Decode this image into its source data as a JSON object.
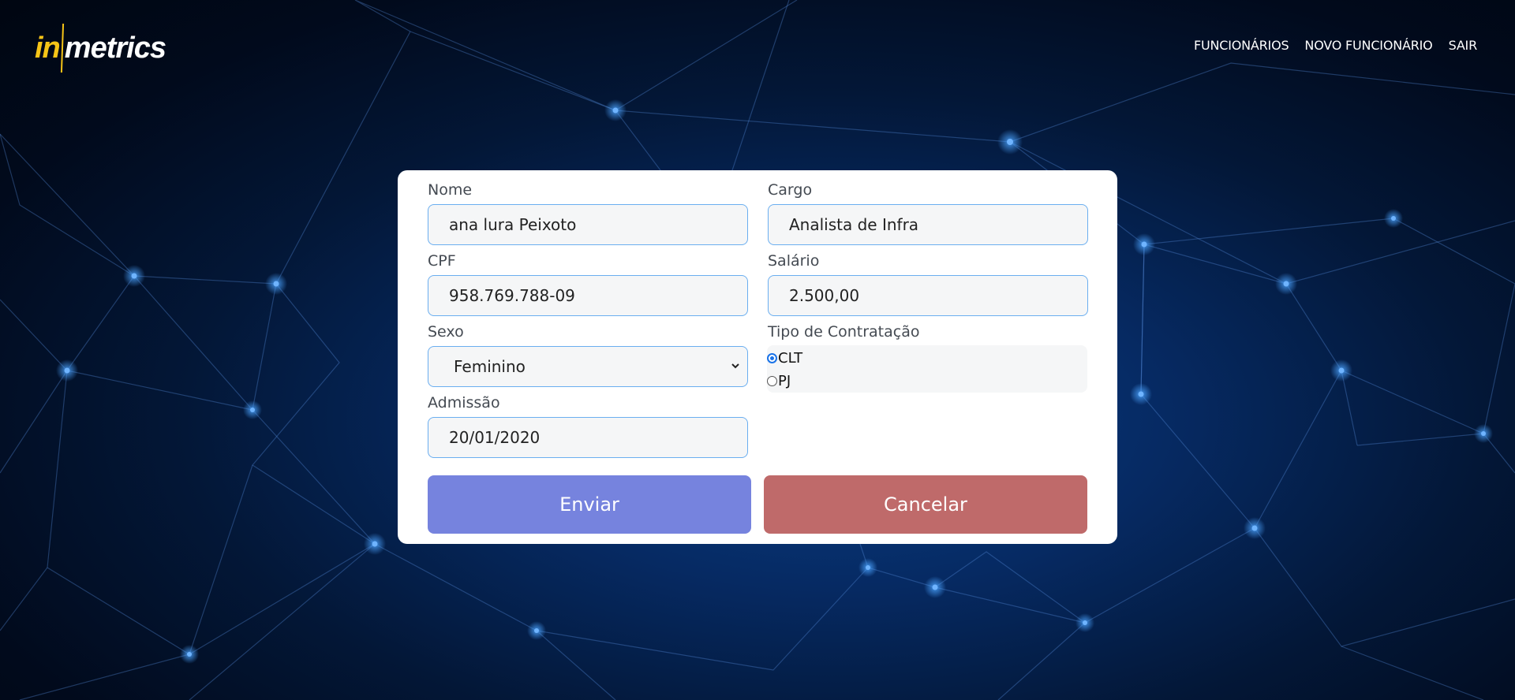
{
  "brand": {
    "logo_in": "in",
    "logo_metrics": "metrics"
  },
  "nav": {
    "items": [
      {
        "label": "FUNCIONÁRIOS"
      },
      {
        "label": "NOVO FUNCIONÁRIO"
      },
      {
        "label": "SAIR"
      }
    ]
  },
  "form": {
    "nome": {
      "label": "Nome",
      "value": "ana lura Peixoto"
    },
    "cargo": {
      "label": "Cargo",
      "value": "Analista de Infra"
    },
    "cpf": {
      "label": "CPF",
      "value": "958.769.788-09"
    },
    "salario": {
      "label": "Salário",
      "value": "2.500,00"
    },
    "sexo": {
      "label": "Sexo",
      "value": "Feminino"
    },
    "tipo_contratacao": {
      "label": "Tipo de Contratação",
      "options": [
        {
          "label": "CLT",
          "checked": true
        },
        {
          "label": "PJ",
          "checked": false
        }
      ]
    },
    "admissao": {
      "label": "Admissão",
      "value": "20/01/2020"
    },
    "submit_label": "Enviar",
    "cancel_label": "Cancelar"
  },
  "colors": {
    "brand_yellow": "#f6c417",
    "submit_button": "#7683de",
    "cancel_button": "#bf6a6a",
    "input_border": "#6aaef0",
    "radio_accent": "#1a73e8"
  }
}
